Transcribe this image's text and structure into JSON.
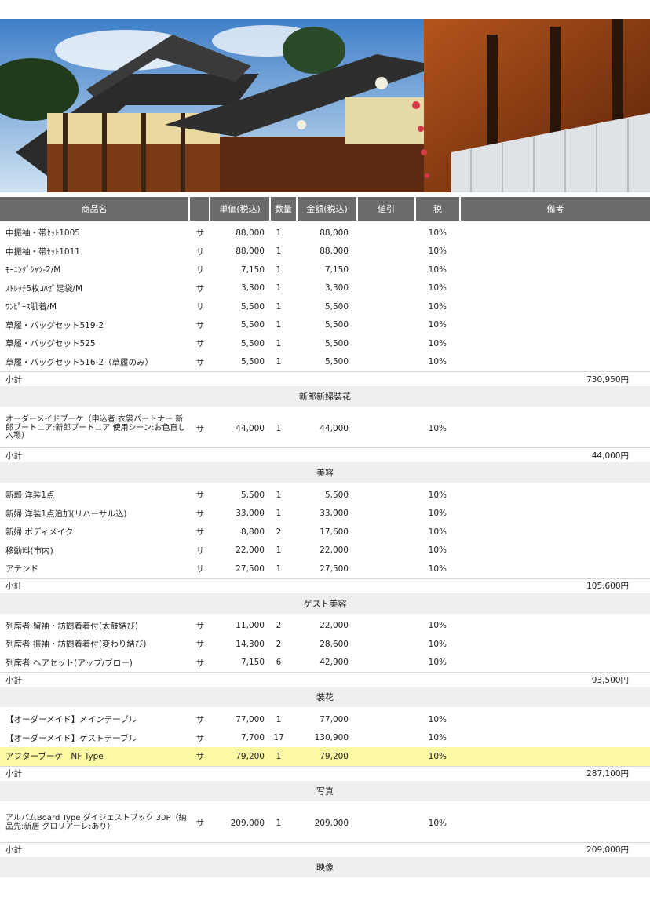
{
  "header": {
    "columns": [
      "商品名",
      "",
      "単価(税込)",
      "数量",
      "金額(税込)",
      "値引",
      "税",
      "備考"
    ]
  },
  "groups": [
    {
      "title": "",
      "items": [
        {
          "name": "中振袖・帯ｾｯﾄ1005",
          "flag": "サ",
          "price": "88,000",
          "qty": "1",
          "amount": "88,000",
          "discount": "",
          "tax": "10%"
        },
        {
          "name": "中振袖・帯ｾｯﾄ1011",
          "flag": "サ",
          "price": "88,000",
          "qty": "1",
          "amount": "88,000",
          "discount": "",
          "tax": "10%"
        },
        {
          "name": "ﾓｰﾆﾝｸﾞｼｬﾂ-2/M",
          "flag": "サ",
          "price": "7,150",
          "qty": "1",
          "amount": "7,150",
          "discount": "",
          "tax": "10%"
        },
        {
          "name": "ｽﾄﾚｯﾁ5枚ｺﾊｾﾞ足袋/M",
          "flag": "サ",
          "price": "3,300",
          "qty": "1",
          "amount": "3,300",
          "discount": "",
          "tax": "10%"
        },
        {
          "name": "ﾜﾝﾋﾟｰｽ肌着/M",
          "flag": "サ",
          "price": "5,500",
          "qty": "1",
          "amount": "5,500",
          "discount": "",
          "tax": "10%"
        },
        {
          "name": "草履・バッグセット519-2",
          "flag": "サ",
          "price": "5,500",
          "qty": "1",
          "amount": "5,500",
          "discount": "",
          "tax": "10%"
        },
        {
          "name": "草履・バッグセット525",
          "flag": "サ",
          "price": "5,500",
          "qty": "1",
          "amount": "5,500",
          "discount": "",
          "tax": "10%"
        },
        {
          "name": "草履・バッグセット516-2（草履のみ）",
          "flag": "サ",
          "price": "5,500",
          "qty": "1",
          "amount": "5,500",
          "discount": "",
          "tax": "10%"
        }
      ],
      "subtotal_label": "小計",
      "subtotal": "730,950円"
    },
    {
      "title": "新郎新婦装花",
      "items": [
        {
          "name": "オーダーメイドブーケ（申込者:衣裳パートナー 新郎ブートニア:新郎ブートニア 使用シーン:お色直し入場）",
          "flag": "サ",
          "price": "44,000",
          "qty": "1",
          "amount": "44,000",
          "discount": "",
          "tax": "10%"
        }
      ],
      "subtotal_label": "小計",
      "subtotal": "44,000円"
    },
    {
      "title": "美容",
      "items": [
        {
          "name": "新郎 洋装1点",
          "flag": "サ",
          "price": "5,500",
          "qty": "1",
          "amount": "5,500",
          "discount": "",
          "tax": "10%"
        },
        {
          "name": "新婦 洋装1点追加(リハーサル込)",
          "flag": "サ",
          "price": "33,000",
          "qty": "1",
          "amount": "33,000",
          "discount": "",
          "tax": "10%"
        },
        {
          "name": "新婦 ボディメイク",
          "flag": "サ",
          "price": "8,800",
          "qty": "2",
          "amount": "17,600",
          "discount": "",
          "tax": "10%"
        },
        {
          "name": "移動料(市内)",
          "flag": "サ",
          "price": "22,000",
          "qty": "1",
          "amount": "22,000",
          "discount": "",
          "tax": "10%"
        },
        {
          "name": "アテンド",
          "flag": "サ",
          "price": "27,500",
          "qty": "1",
          "amount": "27,500",
          "discount": "",
          "tax": "10%"
        }
      ],
      "subtotal_label": "小計",
      "subtotal": "105,600円"
    },
    {
      "title": "ゲスト美容",
      "items": [
        {
          "name": "列席者 留袖・訪問着着付(太鼓結び)",
          "flag": "サ",
          "price": "11,000",
          "qty": "2",
          "amount": "22,000",
          "discount": "",
          "tax": "10%"
        },
        {
          "name": "列席者 振袖・訪問着着付(変わり結び)",
          "flag": "サ",
          "price": "14,300",
          "qty": "2",
          "amount": "28,600",
          "discount": "",
          "tax": "10%"
        },
        {
          "name": "列席者 ヘアセット(アップ/ブロー)",
          "flag": "サ",
          "price": "7,150",
          "qty": "6",
          "amount": "42,900",
          "discount": "",
          "tax": "10%"
        }
      ],
      "subtotal_label": "小計",
      "subtotal": "93,500円"
    },
    {
      "title": "装花",
      "items": [
        {
          "name": "【オーダーメイド】メインテーブル",
          "flag": "サ",
          "price": "77,000",
          "qty": "1",
          "amount": "77,000",
          "discount": "",
          "tax": "10%"
        },
        {
          "name": "【オーダーメイド】ゲストテーブル",
          "flag": "サ",
          "price": "7,700",
          "qty": "17",
          "amount": "130,900",
          "discount": "",
          "tax": "10%"
        },
        {
          "name": "アフターブーケ　NF Type",
          "flag": "サ",
          "price": "79,200",
          "qty": "1",
          "amount": "79,200",
          "discount": "",
          "tax": "10%",
          "highlight": true
        }
      ],
      "subtotal_label": "小計",
      "subtotal": "287,100円"
    },
    {
      "title": "写真",
      "items": [
        {
          "name": "アルバムBoard Type ダイジェストブック 30P（納品先:新居 グロリアーレ:あり）",
          "flag": "サ",
          "price": "209,000",
          "qty": "1",
          "amount": "209,000",
          "discount": "",
          "tax": "10%"
        }
      ],
      "subtotal_label": "小計",
      "subtotal": "209,000円"
    }
  ],
  "last_section_title": "映像",
  "colors": {
    "header_bg": "#6b6b6b",
    "section_bg": "#efefef",
    "highlight": "#fbf9a3"
  }
}
